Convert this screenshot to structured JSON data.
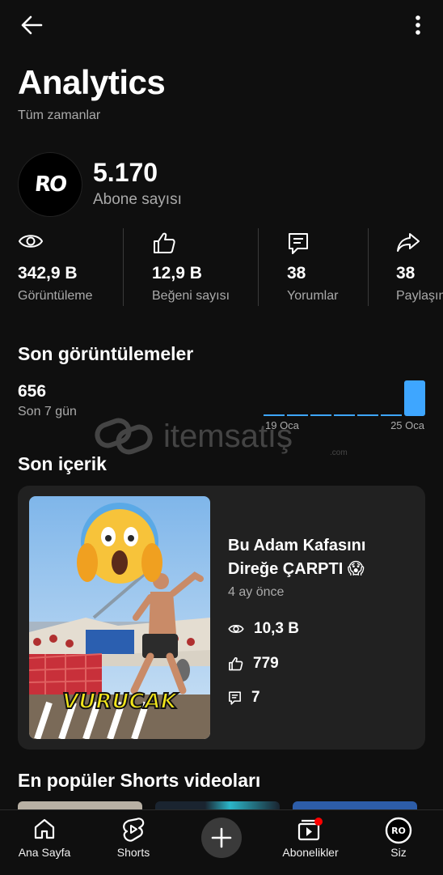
{
  "header": {
    "title": "Analytics",
    "subtitle": "Tüm zamanlar"
  },
  "channel": {
    "avatar_text": "RO",
    "subscriber_count": "5.170",
    "subscriber_label": "Abone sayısı"
  },
  "stats": [
    {
      "value": "342,9 B",
      "label": "Görüntüleme",
      "icon": "eye-icon"
    },
    {
      "value": "12,9 B",
      "label": "Beğeni sayısı",
      "icon": "thumbs-up-icon"
    },
    {
      "value": "38",
      "label": "Yorumlar",
      "icon": "comment-icon"
    },
    {
      "value": "38",
      "label": "Paylaşım",
      "icon": "share-icon"
    }
  ],
  "recent_views": {
    "title": "Son görüntülemeler",
    "value": "656",
    "period": "Son 7 gün",
    "chart_data": {
      "type": "bar",
      "x_start_label": "19 Oca",
      "x_end_label": "25 Oca",
      "values": [
        0,
        0,
        0,
        0,
        0,
        0,
        656
      ],
      "accent": "#3ea6ff"
    }
  },
  "watermark": {
    "text": "itemsatış",
    "suffix": ".com"
  },
  "recent_content": {
    "title": "Son içerik",
    "video": {
      "title": "Bu Adam Kafasını Direğe ÇARPTI 😱",
      "age": "4 ay önce",
      "thumbnail_text": "VURUCAK",
      "views": "10,3 B",
      "likes": "779",
      "comments": "7"
    }
  },
  "popular": {
    "title": "En popüler Shorts videoları"
  },
  "nav": [
    {
      "label": "Ana Sayfa",
      "icon": "home-icon"
    },
    {
      "label": "Shorts",
      "icon": "shorts-icon"
    },
    {
      "label": "",
      "icon": "create-icon"
    },
    {
      "label": "Abonelikler",
      "icon": "subscriptions-icon"
    },
    {
      "label": "Siz",
      "icon": "profile-avatar-icon"
    }
  ],
  "colors": {
    "background": "#0f0f0f",
    "card": "#212121",
    "accent": "#3ea6ff",
    "badge": "#ff0000"
  }
}
